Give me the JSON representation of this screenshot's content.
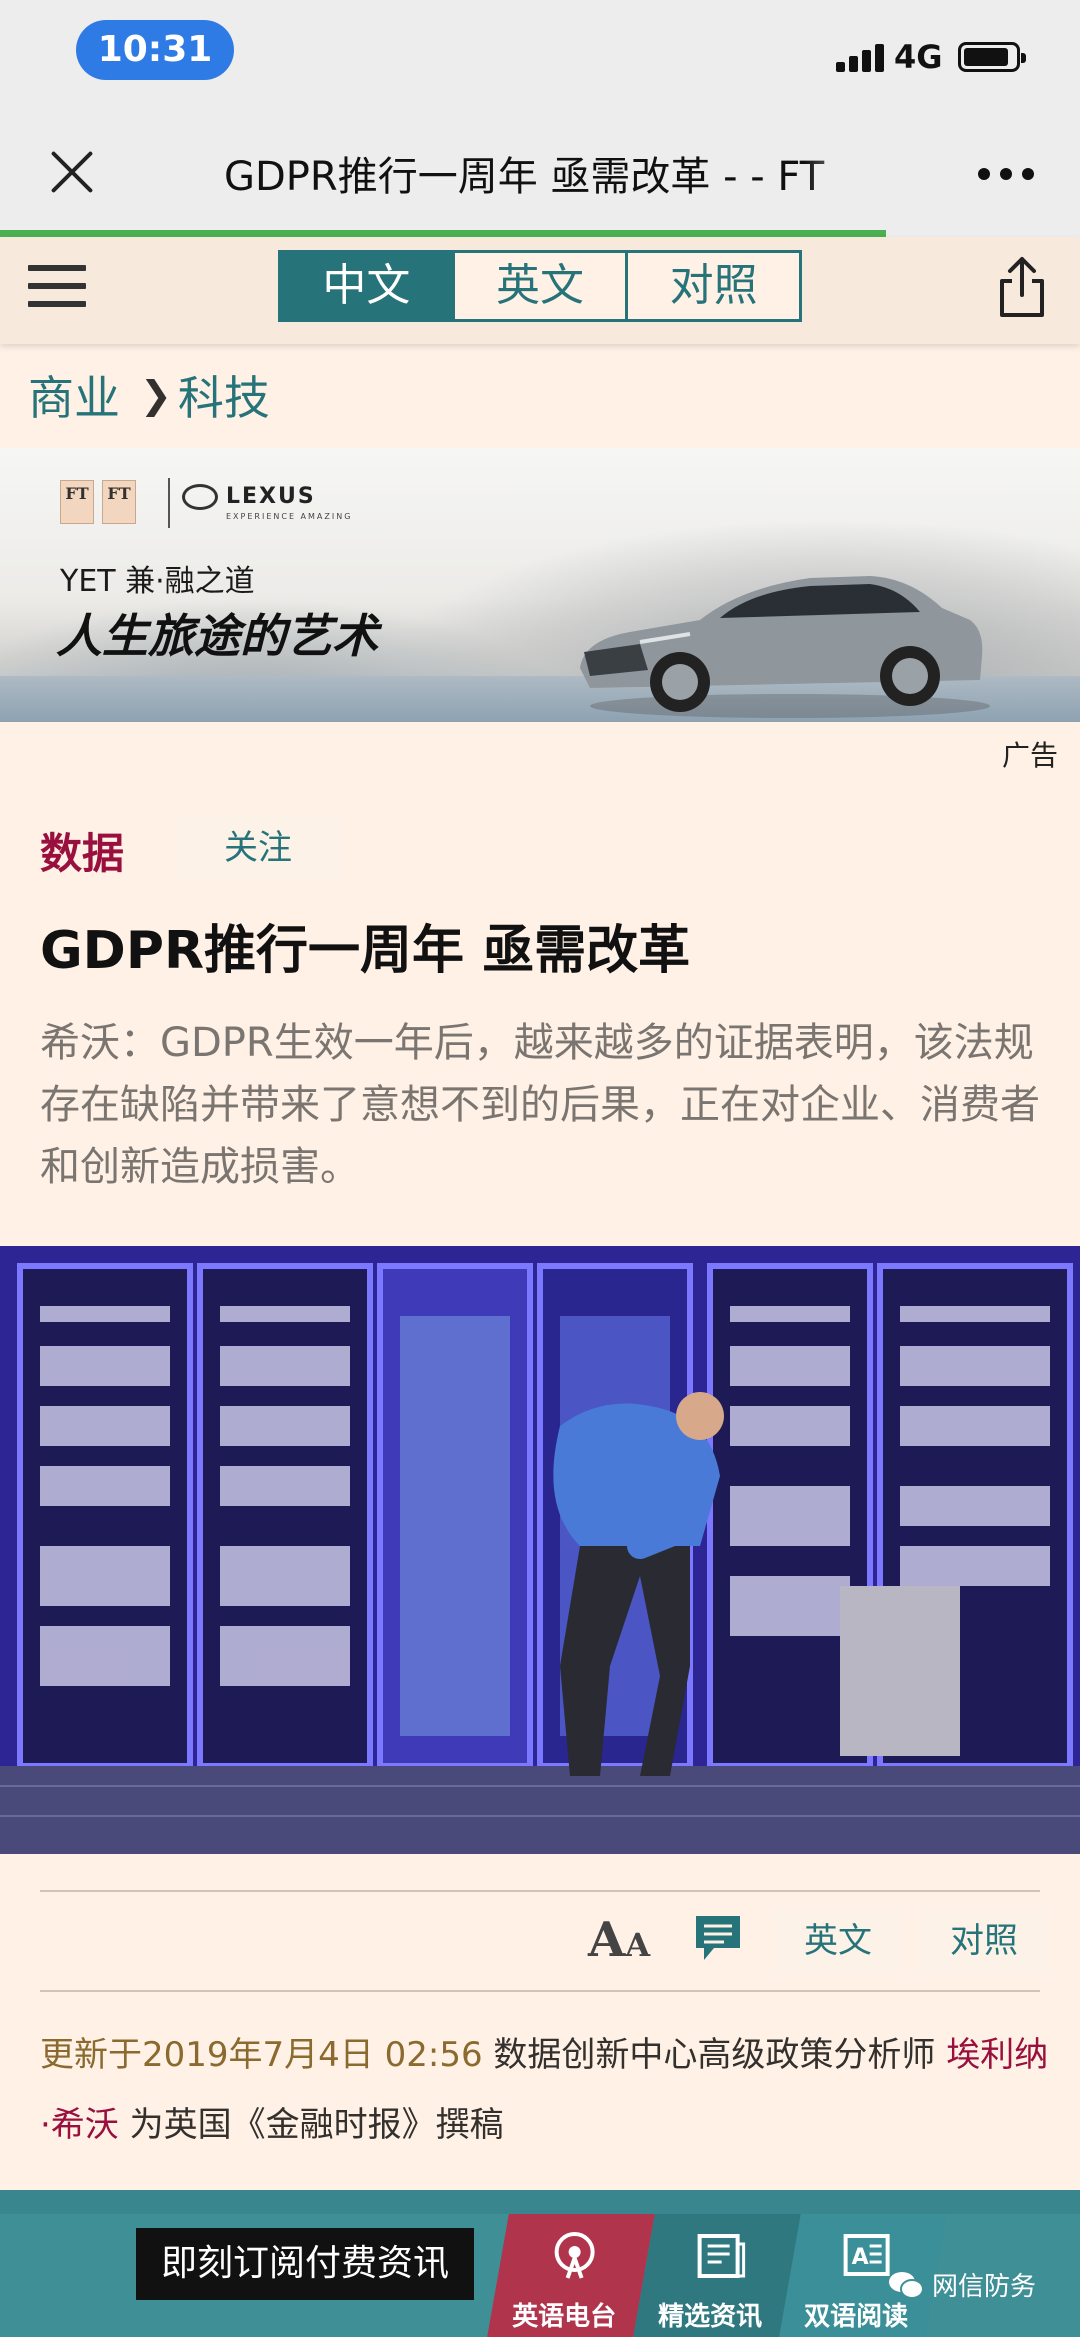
{
  "status_bar": {
    "time": "10:31",
    "network": "4G"
  },
  "nav": {
    "title": "GDPR推行一周年 亟需改革 - - FT"
  },
  "page_load_progress": 0.82,
  "lang_tabs": [
    "中文",
    "英文",
    "对照"
  ],
  "breadcrumb": {
    "section": "商业",
    "subsection": "科技"
  },
  "ad": {
    "brand_ft": "FT",
    "brand_lexus": "LEXUS",
    "brand_lexus_sub": "EXPERIENCE AMAZING",
    "slogan_line1": "YET 兼·融之道",
    "slogan_line2": "人生旅途的艺术",
    "label": "广告"
  },
  "article": {
    "section_tag": "数据",
    "follow_label": "关注",
    "headline": "GDPR推行一周年 亟需改革",
    "standfirst": "希沃：GDPR生效一年后，越来越多的证据表明，该法规存在缺陷并带来了意想不到的后果，正在对企业、消费者和创新造成损害。",
    "toolbar": {
      "font_size_label_big": "A",
      "font_size_label_small": "A",
      "english_label": "英文",
      "bilingual_label": "对照"
    },
    "byline": {
      "updated": "更新于2019年7月4日 02:56",
      "role": "数据创新中心高级政策分析师",
      "author": "埃利纳·希沃",
      "suffix": "为英国《金融时报》撰稿"
    }
  },
  "bottom_bar": {
    "subscribe_label": "即刻订阅付费资讯",
    "tabs": [
      {
        "label": "英语电台",
        "icon": "radio-icon"
      },
      {
        "label": "精选资讯",
        "icon": "newspaper-icon"
      },
      {
        "label": "双语阅读",
        "icon": "bilingual-reading-icon"
      }
    ],
    "watermark": "网信防务"
  },
  "colors": {
    "teal": "#26747a",
    "claret": "#990f3d",
    "paper": "#fff1e5",
    "progress": "#4bb04f"
  }
}
